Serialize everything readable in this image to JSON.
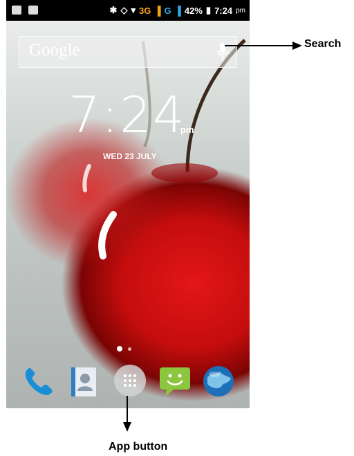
{
  "status_bar": {
    "icons_left": [
      "notification-icon",
      "screenshot-icon"
    ],
    "icons_right": [
      "bluetooth-icon",
      "rotation-icon",
      "wifi-icon"
    ],
    "network_3g": "3G",
    "network_g": "G",
    "battery_percent": "42%",
    "time": "7:24",
    "time_suffix": "pm"
  },
  "search_widget": {
    "logo_text": "Google",
    "mic_icon": "microphone-icon"
  },
  "clock_widget": {
    "time": "7:24",
    "suffix": "pm",
    "date": "WED 23 JULY"
  },
  "page_indicator": {
    "pages": 2,
    "current": 1
  },
  "dock": {
    "items": [
      {
        "name": "Phone",
        "icon": "phone-icon"
      },
      {
        "name": "Contacts",
        "icon": "contacts-icon"
      },
      {
        "name": "All apps",
        "icon": "app-drawer-icon"
      },
      {
        "name": "Messaging",
        "icon": "messaging-icon"
      },
      {
        "name": "Browser",
        "icon": "globe-icon"
      }
    ]
  },
  "annotations": {
    "search_label": "Search",
    "app_button_label": "App button"
  },
  "colors": {
    "wallpaper_red": "#d41414",
    "status_bar_bg": "#000000",
    "network_3g": "#f3a21b",
    "network_g": "#2aa8e0"
  }
}
